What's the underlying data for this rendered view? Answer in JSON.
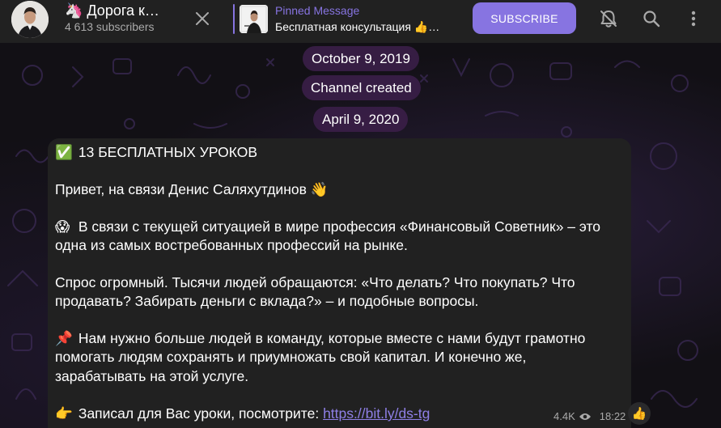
{
  "header": {
    "title": "🦄 Дорога к…",
    "subscribers": "4 613 subscribers",
    "pinned_label": "Pinned Message",
    "pinned_text": "Бесплатная консультация 👍…",
    "subscribe_label": "SUBSCRIBE"
  },
  "chat": {
    "date1": "October 9, 2019",
    "service": "Channel created",
    "date2": "April 9, 2020"
  },
  "message": {
    "line1_emoji": "✅",
    "line1_text": "13 БЕСПЛАТНЫХ УРОКОВ",
    "line2_text": "Привет, на связи Денис Саляхутдинов 👋",
    "line3_emoji": "😱",
    "line3_text": "В связи с текущей ситуацией в мире профессия «Финансовый Советник» – это",
    "line4_text": "одна из самых востребованных профессий на рынке.",
    "line5_text": "Спрос огромный. Тысячи людей обращаются: «Что делать? Что покупать? Что",
    "line6_text": "продавать? Забирать деньги с вклада?» – и подобные вопросы.",
    "line7_emoji": "📌",
    "line7_text": "Нам нужно больше людей в команду, которые вместе с нами будут грамотно",
    "line8_text": "помогать людям сохранять и приумножать свой капитал. И конечно же,",
    "line9_text": "зарабатывать на этой услуге.",
    "line10_emoji": "👉",
    "line10_text": "Записал для Вас уроки, посмотрите: ",
    "link": "https://bit.ly/ds-tg",
    "views": "4.4K",
    "time": "18:22",
    "reaction": "👍"
  },
  "colors": {
    "accent": "#8774e1",
    "header_bg": "#212121",
    "bubble_bg": "#212121",
    "pill_bg": "#3a1e48"
  },
  "icons": [
    "close-icon",
    "mute-bell-icon",
    "search-icon",
    "more-vertical-icon",
    "eye-icon"
  ]
}
